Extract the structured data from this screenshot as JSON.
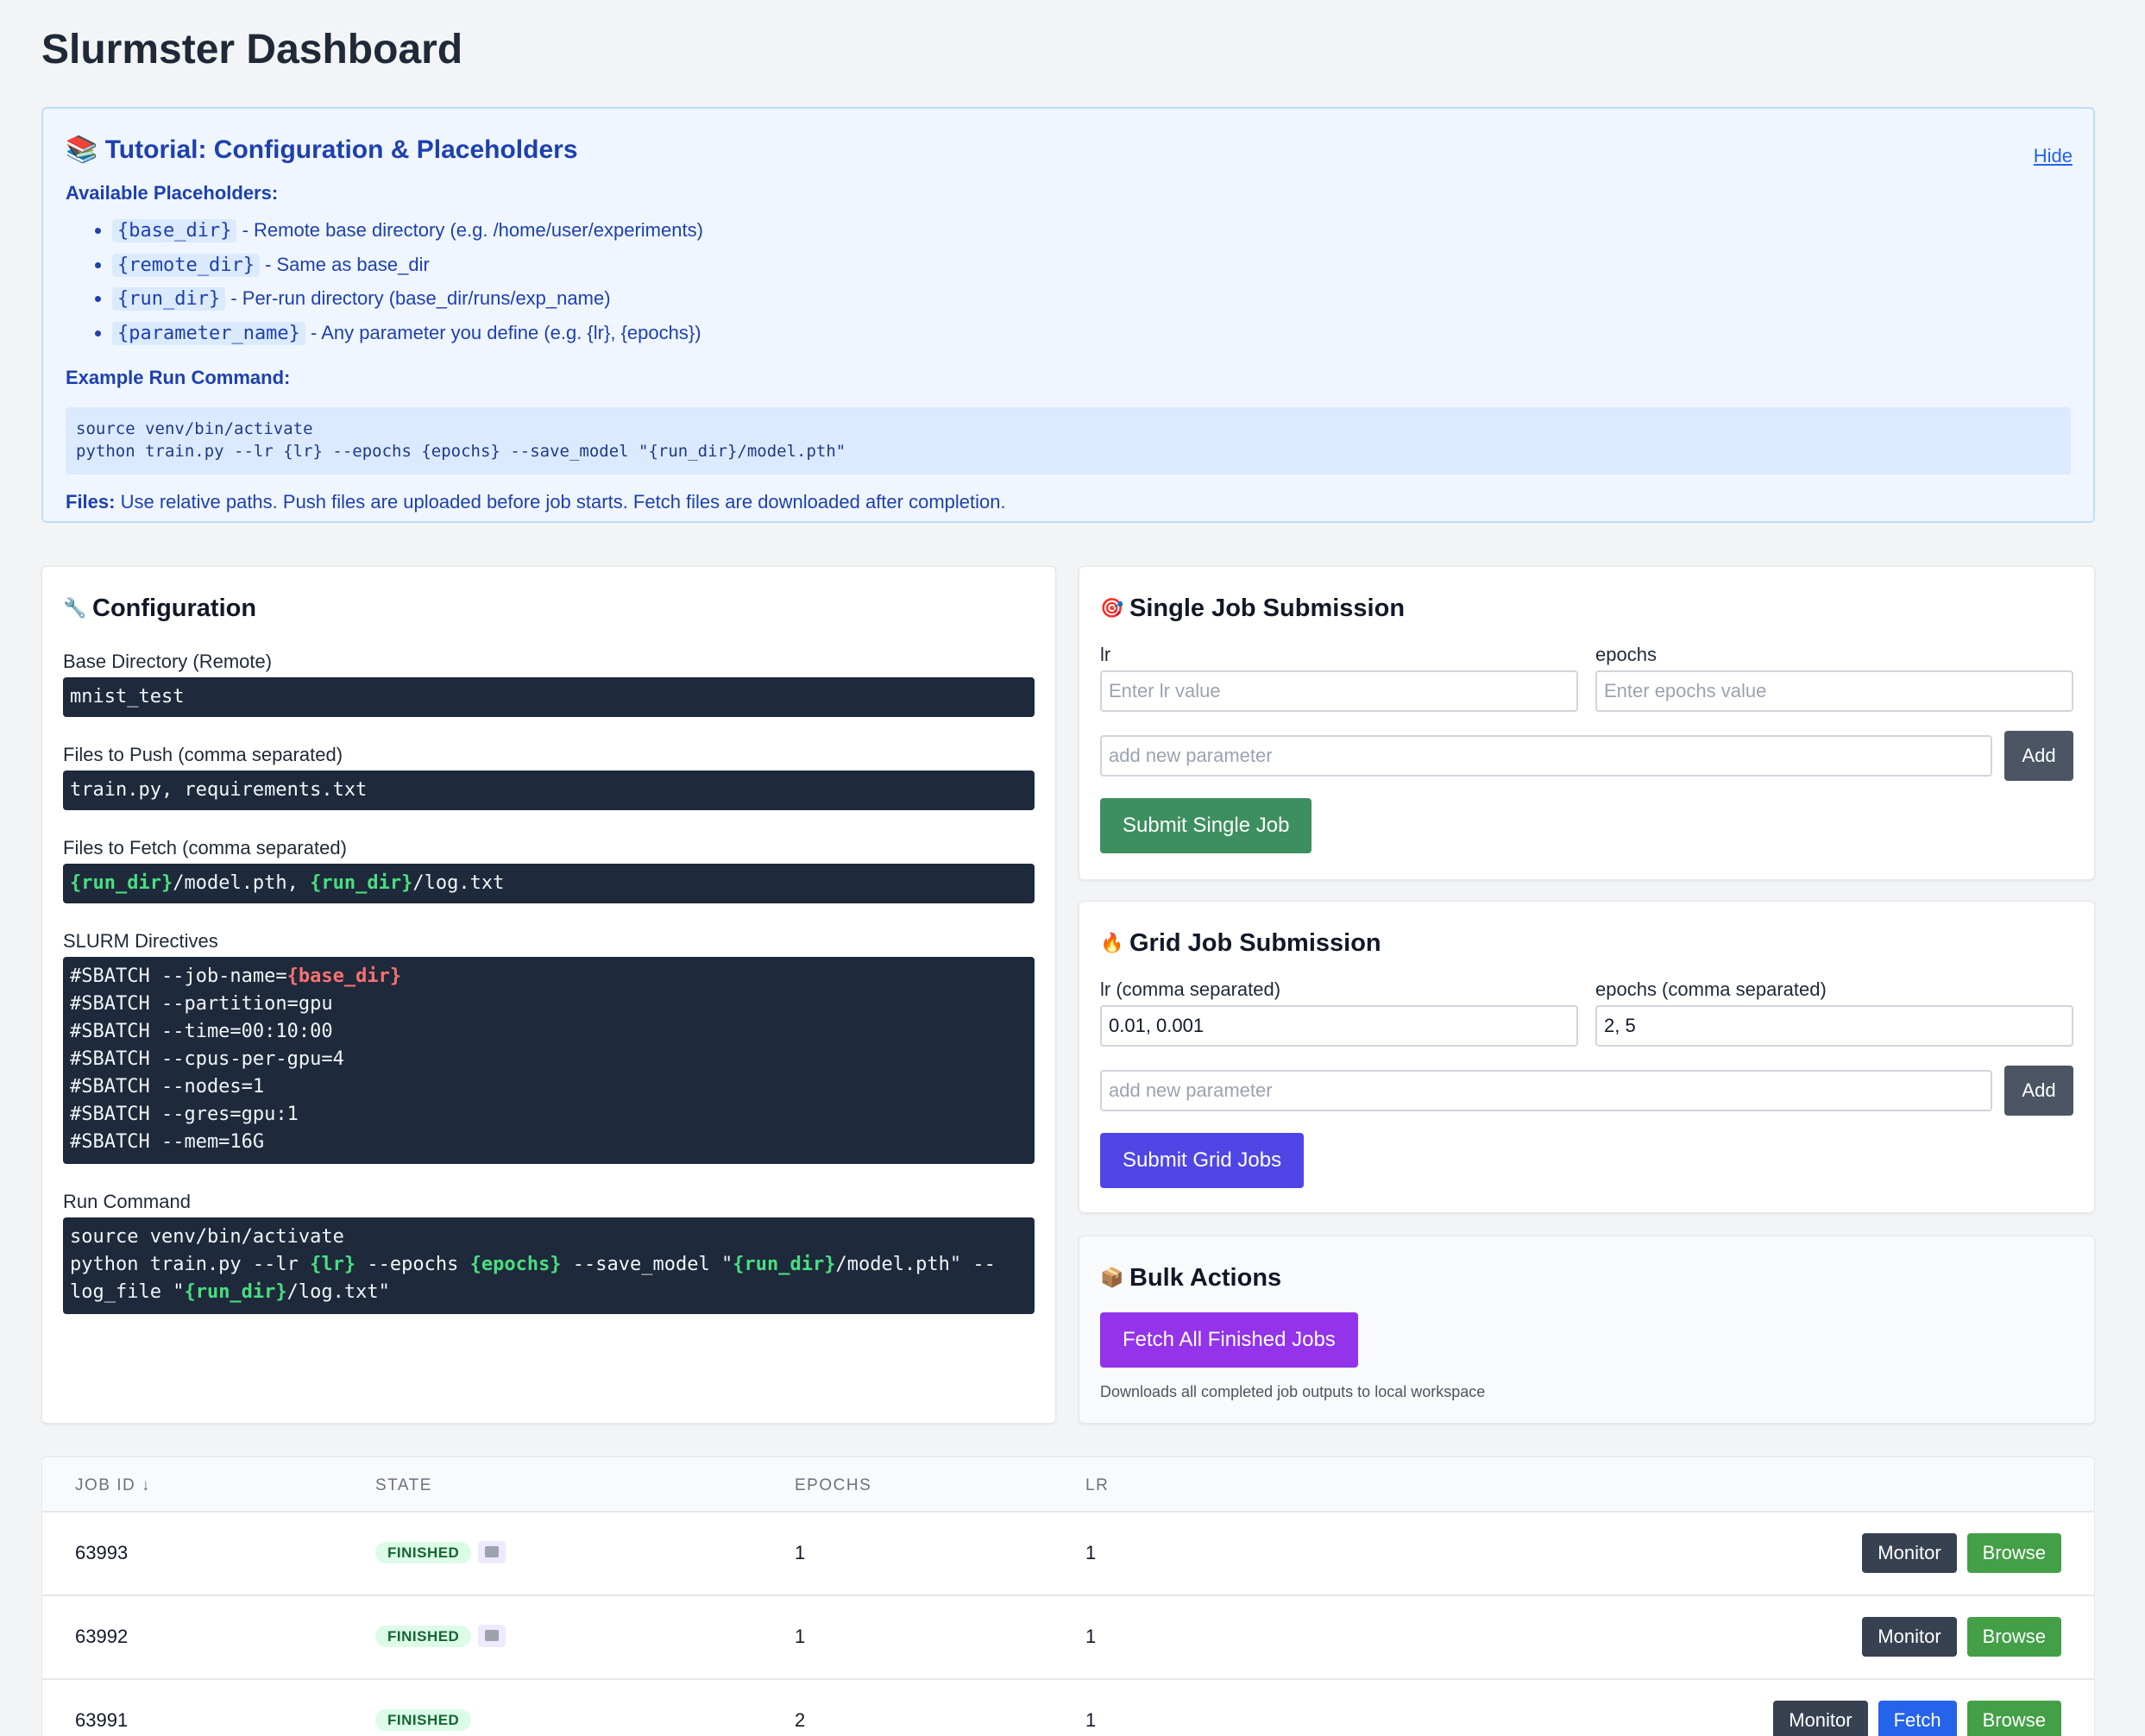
{
  "page": {
    "title": "Slurmster Dashboard"
  },
  "tutorial": {
    "title": "Tutorial: Configuration & Placeholders",
    "hide_label": "Hide",
    "placeholders_heading": "Available Placeholders:",
    "placeholders": [
      {
        "code": "{base_dir}",
        "desc": " - Remote base directory (e.g. /home/user/experiments)"
      },
      {
        "code": "{remote_dir}",
        "desc": " - Same as base_dir"
      },
      {
        "code": "{run_dir}",
        "desc": " - Per-run directory (base_dir/runs/exp_name)"
      },
      {
        "code": "{parameter_name}",
        "desc": " - Any parameter you define (e.g. {lr}, {epochs})"
      }
    ],
    "example_heading": "Example Run Command:",
    "example_lines": [
      "source venv/bin/activate",
      "python train.py --lr {lr} --epochs {epochs} --save_model \"{run_dir}/model.pth\""
    ],
    "files_label": "Files:",
    "files_text": " Use relative paths. Push files are uploaded before job starts. Fetch files are downloaded after completion."
  },
  "config": {
    "title": "Configuration",
    "base_dir_label": "Base Directory (Remote)",
    "base_dir_value": "mnist_test",
    "push_label": "Files to Push (comma separated)",
    "push_value": "train.py, requirements.txt",
    "fetch_label": "Files to Fetch (comma separated)",
    "fetch_ph1": "{run_dir}",
    "fetch_mid": "/model.pth, ",
    "fetch_ph2": "{run_dir}",
    "fetch_end": "/log.txt",
    "slurm_label": "SLURM Directives",
    "slurm_first_prefix": "#SBATCH --job-name=",
    "slurm_first_ph": "{base_dir}",
    "slurm_lines": [
      "#SBATCH --partition=gpu",
      "#SBATCH --time=00:10:00",
      "#SBATCH --cpus-per-gpu=4",
      "#SBATCH --nodes=1",
      "#SBATCH --gres=gpu:1",
      "#SBATCH --mem=16G"
    ],
    "run_label": "Run Command",
    "run_line1": "source venv/bin/activate",
    "run_l2_a": "python train.py --lr ",
    "run_l2_ph1": "{lr}",
    "run_l2_b": " --epochs ",
    "run_l2_ph2": "{epochs}",
    "run_l2_c": " --save_model \"",
    "run_l2_ph3": "{run_dir}",
    "run_l2_d": "/model.pth\" --",
    "run_l3_a": "log_file \"",
    "run_l3_ph": "{run_dir}",
    "run_l3_b": "/log.txt\""
  },
  "single": {
    "title": "Single Job Submission",
    "lr_label": "lr",
    "lr_placeholder": "Enter lr value",
    "epochs_label": "epochs",
    "epochs_placeholder": "Enter epochs value",
    "new_param_placeholder": "add new parameter",
    "add_label": "Add",
    "submit_label": "Submit Single Job"
  },
  "grid": {
    "title": "Grid Job Submission",
    "lr_label": "lr (comma separated)",
    "lr_value": "0.01, 0.001",
    "epochs_label": "epochs (comma separated)",
    "epochs_value": "2, 5",
    "new_param_placeholder": "add new parameter",
    "add_label": "Add",
    "submit_label": "Submit Grid Jobs"
  },
  "bulk": {
    "title": "Bulk Actions",
    "fetch_all_label": "Fetch All Finished Jobs",
    "note": "Downloads all completed job outputs to local workspace"
  },
  "jobs": {
    "headers": {
      "job_id": "JOB ID ↓",
      "state": "STATE",
      "epochs": "EPOCHS",
      "lr": "LR"
    },
    "monitor_label": "Monitor",
    "browse_label": "Browse",
    "fetch_label": "Fetch",
    "rows": [
      {
        "id": "63993",
        "state": "FINISHED",
        "epochs": "1",
        "lr": "1"
      },
      {
        "id": "63992",
        "state": "FINISHED",
        "epochs": "1",
        "lr": "1"
      },
      {
        "id": "63991",
        "state": "FINISHED",
        "epochs": "2",
        "lr": "1"
      }
    ]
  },
  "icons": {
    "tutorial": "books-icon",
    "config": "wrench-icon",
    "single": "target-icon",
    "grid": "fire-icon",
    "bulk": "package-icon",
    "folder": "folder-icon"
  },
  "colors": {
    "submit_single": "#3d8f5f",
    "submit_grid": "#4f46e5",
    "fetch_all": "#9333ea",
    "browse": "#43a047",
    "fetch": "#2563eb",
    "monitor": "#374151"
  }
}
